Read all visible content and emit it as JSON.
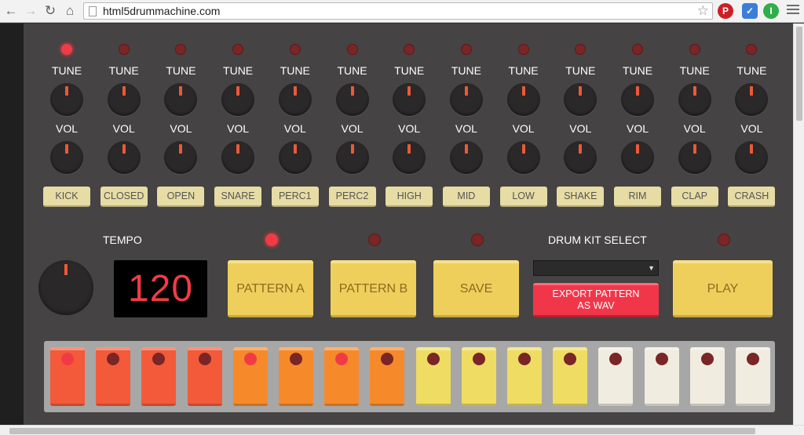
{
  "browser": {
    "url": "html5drummachine.com",
    "back_icon": "arrow-left",
    "forward_icon": "arrow-right",
    "reload_icon": "reload",
    "home_icon": "home",
    "bookmark_icon": "star",
    "extensions": [
      "pinterest",
      "check",
      "ig"
    ]
  },
  "channels": [
    {
      "name": "KICK",
      "tune_label": "TUNE",
      "vol_label": "VOL",
      "led_on": true
    },
    {
      "name": "CLOSED",
      "tune_label": "TUNE",
      "vol_label": "VOL",
      "led_on": false
    },
    {
      "name": "OPEN",
      "tune_label": "TUNE",
      "vol_label": "VOL",
      "led_on": false
    },
    {
      "name": "SNARE",
      "tune_label": "TUNE",
      "vol_label": "VOL",
      "led_on": false
    },
    {
      "name": "PERC1",
      "tune_label": "TUNE",
      "vol_label": "VOL",
      "led_on": false
    },
    {
      "name": "PERC2",
      "tune_label": "TUNE",
      "vol_label": "VOL",
      "led_on": false
    },
    {
      "name": "HIGH",
      "tune_label": "TUNE",
      "vol_label": "VOL",
      "led_on": false
    },
    {
      "name": "MID",
      "tune_label": "TUNE",
      "vol_label": "VOL",
      "led_on": false
    },
    {
      "name": "LOW",
      "tune_label": "TUNE",
      "vol_label": "VOL",
      "led_on": false
    },
    {
      "name": "SHAKE",
      "tune_label": "TUNE",
      "vol_label": "VOL",
      "led_on": false
    },
    {
      "name": "RIM",
      "tune_label": "TUNE",
      "vol_label": "VOL",
      "led_on": false
    },
    {
      "name": "CLAP",
      "tune_label": "TUNE",
      "vol_label": "VOL",
      "led_on": false
    },
    {
      "name": "CRASH",
      "tune_label": "TUNE",
      "vol_label": "VOL",
      "led_on": false
    }
  ],
  "tempo": {
    "label": "TEMPO",
    "value": "120"
  },
  "patterns": [
    {
      "label": "PATTERN A",
      "led_on": true
    },
    {
      "label": "PATTERN B",
      "led_on": false
    },
    {
      "label": "SAVE",
      "led_on": false
    }
  ],
  "kit": {
    "label": "DRUM KIT SELECT",
    "selected": ""
  },
  "export": {
    "label": "EXPORT PATTERN AS WAV"
  },
  "play": {
    "label": "PLAY",
    "led_on": false
  },
  "colors": {
    "accent_red": "#f03b45",
    "led_off": "#7a2526",
    "button_yellow": "#efcf5c",
    "instrument_button": "#e6dca4",
    "group_red": "#f35a3a",
    "group_orange": "#f68a2a",
    "group_yellow": "#efdc62",
    "group_white": "#f1ece0"
  },
  "steps": [
    {
      "group": "red",
      "active": true
    },
    {
      "group": "red",
      "active": false
    },
    {
      "group": "red",
      "active": false
    },
    {
      "group": "red",
      "active": false
    },
    {
      "group": "orange",
      "active": true
    },
    {
      "group": "orange",
      "active": false
    },
    {
      "group": "orange",
      "active": true
    },
    {
      "group": "orange",
      "active": false
    },
    {
      "group": "yellow",
      "active": false
    },
    {
      "group": "yellow",
      "active": false
    },
    {
      "group": "yellow",
      "active": false
    },
    {
      "group": "yellow",
      "active": false
    },
    {
      "group": "white",
      "active": false
    },
    {
      "group": "white",
      "active": false
    },
    {
      "group": "white",
      "active": false
    },
    {
      "group": "white",
      "active": false
    }
  ]
}
